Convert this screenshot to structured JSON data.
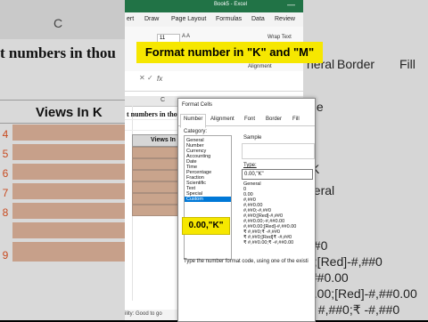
{
  "background": {
    "column_letter": "C",
    "heading_fragment": "t numbers in thou",
    "views_header": "Views In K",
    "row_numbers": [
      "4",
      "5",
      "6",
      "7",
      "8",
      "9"
    ],
    "right_fragments": {
      "fill": "Fill",
      "border": "Border",
      "ple": "ple",
      "cursor_k": "\"K",
      "general": "neral",
      "zero": "0",
      "hash": "##0",
      "red": "0;[Red]-#,##0",
      "dash": ",##0.00",
      "red2": "0.00;[Red]-#,##0.00",
      "rs": "₹ #,##0;₹ -#,##0",
      "rs2": "₹ ##,##0;[Red]₹ -#,#",
      "rs3": "0.00;₹ -#,##0.00"
    }
  },
  "excel": {
    "title": "Book5  -  Excel",
    "minimize_glyph": "—",
    "tabs": [
      "ert",
      "Draw",
      "Page Layout",
      "Formulas",
      "Data",
      "Review"
    ],
    "font_size": "11",
    "wrap_text": "Wrap Text",
    "ribbon_glyphs": "A  A",
    "alignment_group": "Alignment",
    "formula_x": "✕",
    "formula_check": "✓",
    "formula_fx": "fx",
    "col_letter": "C",
    "sheet_heading": "t numbers in thou",
    "views_header": "Views In K",
    "status": "ility: Good to go"
  },
  "banner": "Format number in \"K\" and \"M\"",
  "dialog": {
    "title": "Format Cells",
    "tabs": [
      "Number",
      "Alignment",
      "Font",
      "Border",
      "Fill"
    ],
    "category_label": "Category:",
    "categories": [
      "General",
      "Number",
      "Currency",
      "Accounting",
      "Date",
      "Time",
      "Percentage",
      "Fraction",
      "Scientific",
      "Text",
      "Special",
      "Custom"
    ],
    "selected_category": "Custom",
    "sample_label": "Sample",
    "type_label": "Type:",
    "type_value": "0.00,\"K\"",
    "formats": [
      "General",
      "0",
      "0.00",
      "#,##0",
      "#,##0.00",
      "#,##0;-#,##0",
      "#,##0;[Red]-#,##0",
      "#,##0.00;-#,##0.00",
      "#,##0.00;[Red]-#,##0.00",
      "₹ #,##0;₹ -#,##0",
      "₹ #,##0;[Red]₹ -#,##0",
      "₹ #,##0.00;₹ -#,##0.00"
    ],
    "hint": "Type the number format code, using one of the existi"
  },
  "callout": "0.00,\"K\""
}
